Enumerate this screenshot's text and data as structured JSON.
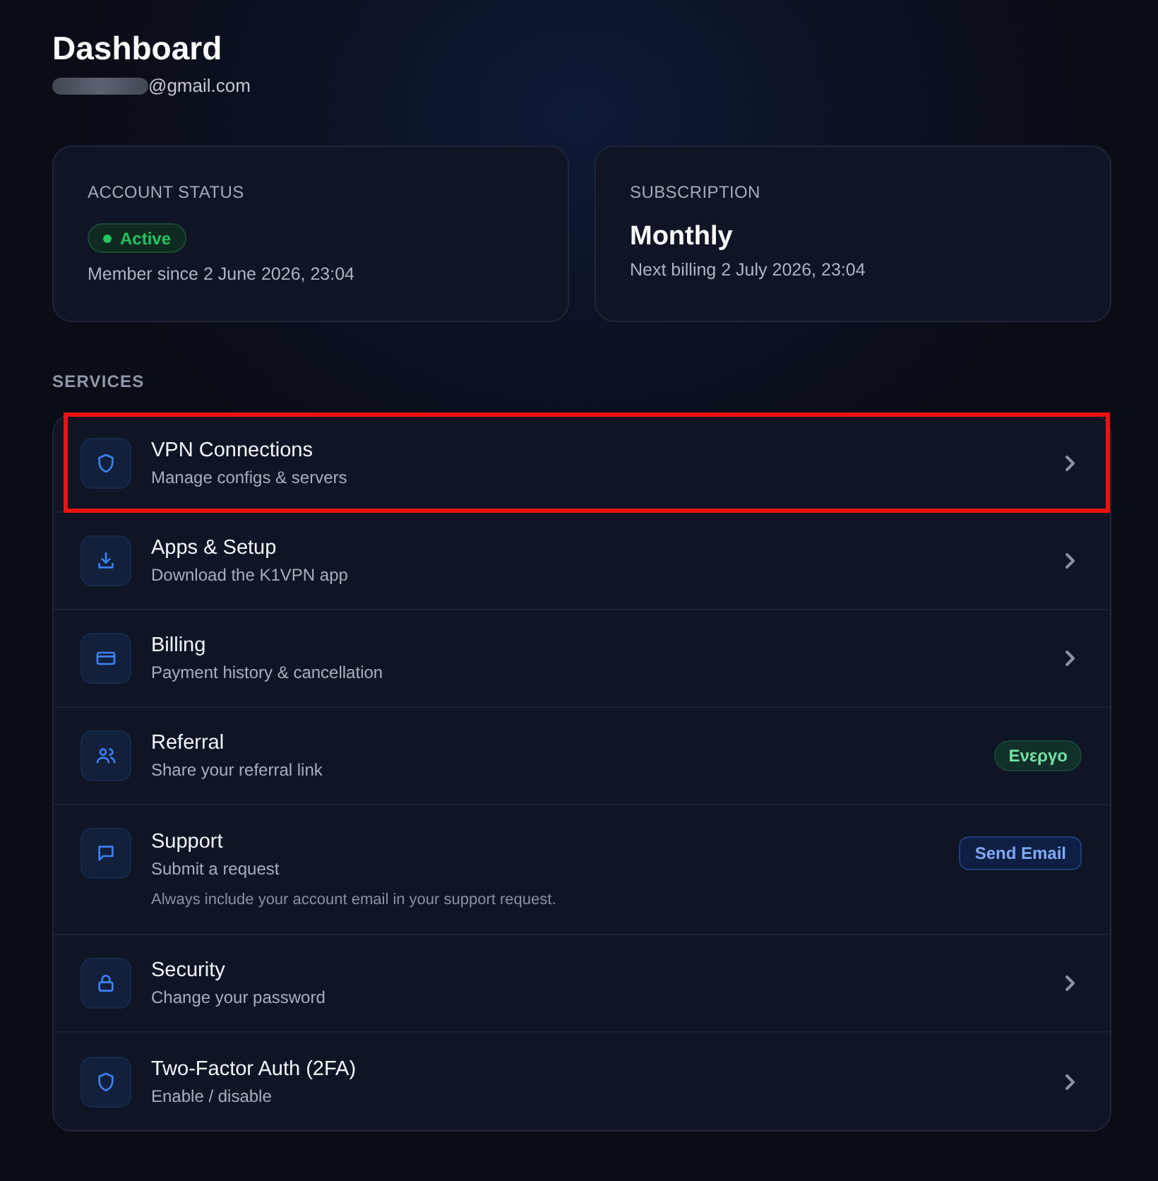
{
  "header": {
    "title": "Dashboard",
    "email": {
      "redacted": true,
      "domain": "@gmail.com"
    }
  },
  "cards": [
    {
      "kind": "status",
      "label": "ACCOUNT STATUS",
      "badge": "Active",
      "detail": "Member since 2 June 2026, 23:04"
    },
    {
      "kind": "plan",
      "label": "SUBSCRIPTION",
      "value": "Monthly",
      "detail": "Next billing 2 July 2026, 23:04"
    }
  ],
  "services": {
    "heading": "SERVICES",
    "items": [
      {
        "title": "VPN Connections",
        "subtitle": "Manage configs & servers",
        "kind": "chevron",
        "highlighted": true
      },
      {
        "title": "Apps & Setup",
        "subtitle": "Download the K1VPN app",
        "kind": "chevron",
        "highlighted": false
      },
      {
        "title": "Billing",
        "subtitle": "Payment history & cancellation",
        "kind": "chevron",
        "highlighted": false
      },
      {
        "title": "Referral",
        "subtitle": "Share your referral link",
        "kind": "badge",
        "badge": "Ενεργο",
        "highlighted": false
      },
      {
        "title": "Support",
        "subtitle": "Submit a request",
        "note": "Always include your account email in your support request.",
        "kind": "button",
        "button": "Send Email",
        "highlighted": false
      },
      {
        "title": "Security",
        "subtitle": "Change your password",
        "kind": "chevron",
        "highlighted": false
      },
      {
        "title": "Two-Factor Auth (2FA)",
        "subtitle": "Enable / disable",
        "kind": "chevron",
        "highlighted": false
      }
    ]
  }
}
